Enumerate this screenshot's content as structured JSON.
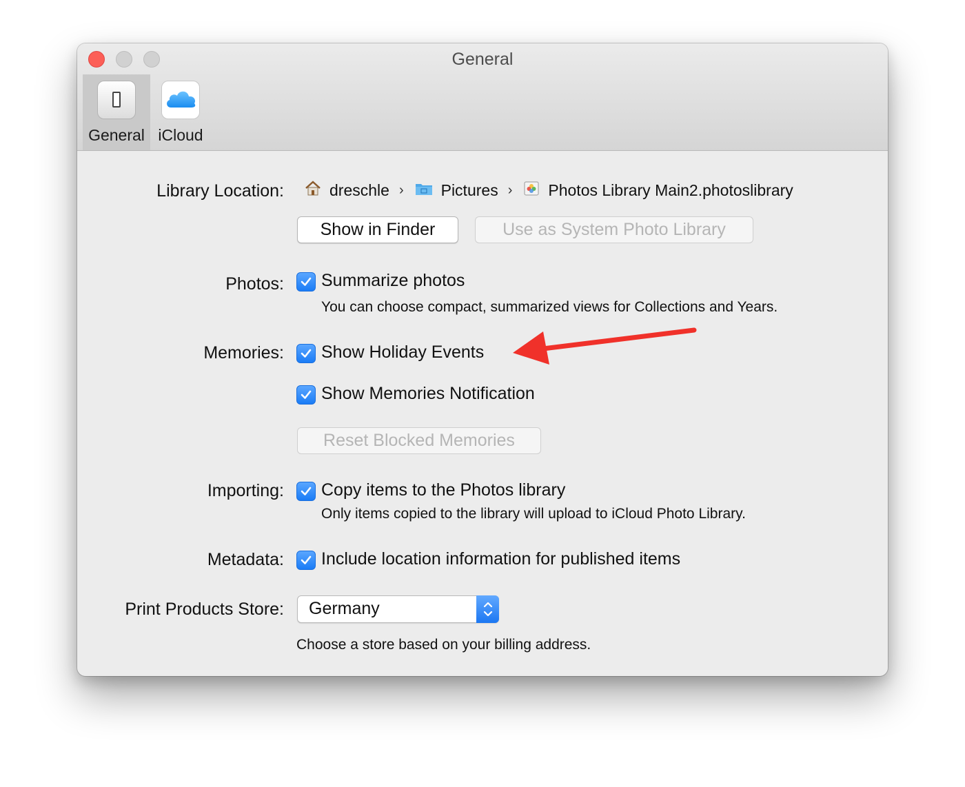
{
  "window": {
    "title": "General",
    "tabs": [
      {
        "label": "General",
        "icon": "switch-icon",
        "selected": true
      },
      {
        "label": "iCloud",
        "icon": "icloud-icon",
        "selected": false
      }
    ]
  },
  "library": {
    "label": "Library Location:",
    "path": [
      {
        "name": "dreschle",
        "icon": "home-icon"
      },
      {
        "name": "Pictures",
        "icon": "folder-icon"
      },
      {
        "name": "Photos Library Main2.photoslibrary",
        "icon": "photos-library-icon"
      }
    ],
    "show_in_finder": "Show in Finder",
    "use_as_system": "Use as System Photo Library"
  },
  "photos": {
    "label": "Photos:",
    "summarize": {
      "label": "Summarize photos",
      "checked": true
    },
    "summarize_desc": "You can choose compact, summarized views for Collections and Years."
  },
  "memories": {
    "label": "Memories:",
    "holiday": {
      "label": "Show Holiday Events",
      "checked": true
    },
    "notification": {
      "label": "Show Memories Notification",
      "checked": true
    },
    "reset_button": "Reset Blocked Memories"
  },
  "importing": {
    "label": "Importing:",
    "copy": {
      "label": "Copy items to the Photos library",
      "checked": true
    },
    "copy_desc": "Only items copied to the library will upload to iCloud Photo Library."
  },
  "metadata": {
    "label": "Metadata:",
    "location": {
      "label": "Include location information for published items",
      "checked": true
    }
  },
  "print_store": {
    "label": "Print Products Store:",
    "selected": "Germany",
    "desc": "Choose a store based on your billing address."
  },
  "colors": {
    "accent": "#1a7cf6",
    "close_button": "#fc5f57",
    "annotation_arrow": "#f0312a"
  }
}
